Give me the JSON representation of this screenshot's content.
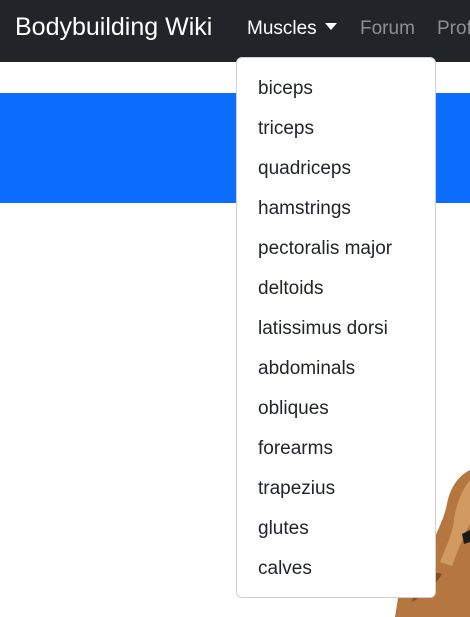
{
  "navbar": {
    "brand": "Bodybuilding Wiki",
    "links": [
      {
        "label": "Muscles",
        "active": true
      },
      {
        "label": "Forum"
      },
      {
        "label": "Profile"
      }
    ]
  },
  "dropdown": {
    "items": [
      "biceps",
      "triceps",
      "quadriceps",
      "hamstrings",
      "pectoralis major",
      "deltoids",
      "latissimus dorsi",
      "abdominals",
      "obliques",
      "forearms",
      "trapezius",
      "glutes",
      "calves"
    ]
  },
  "colors": {
    "navbar_bg": "#212529",
    "banner_bg": "#0d6efd",
    "nav_muted": "#8c8f93"
  }
}
